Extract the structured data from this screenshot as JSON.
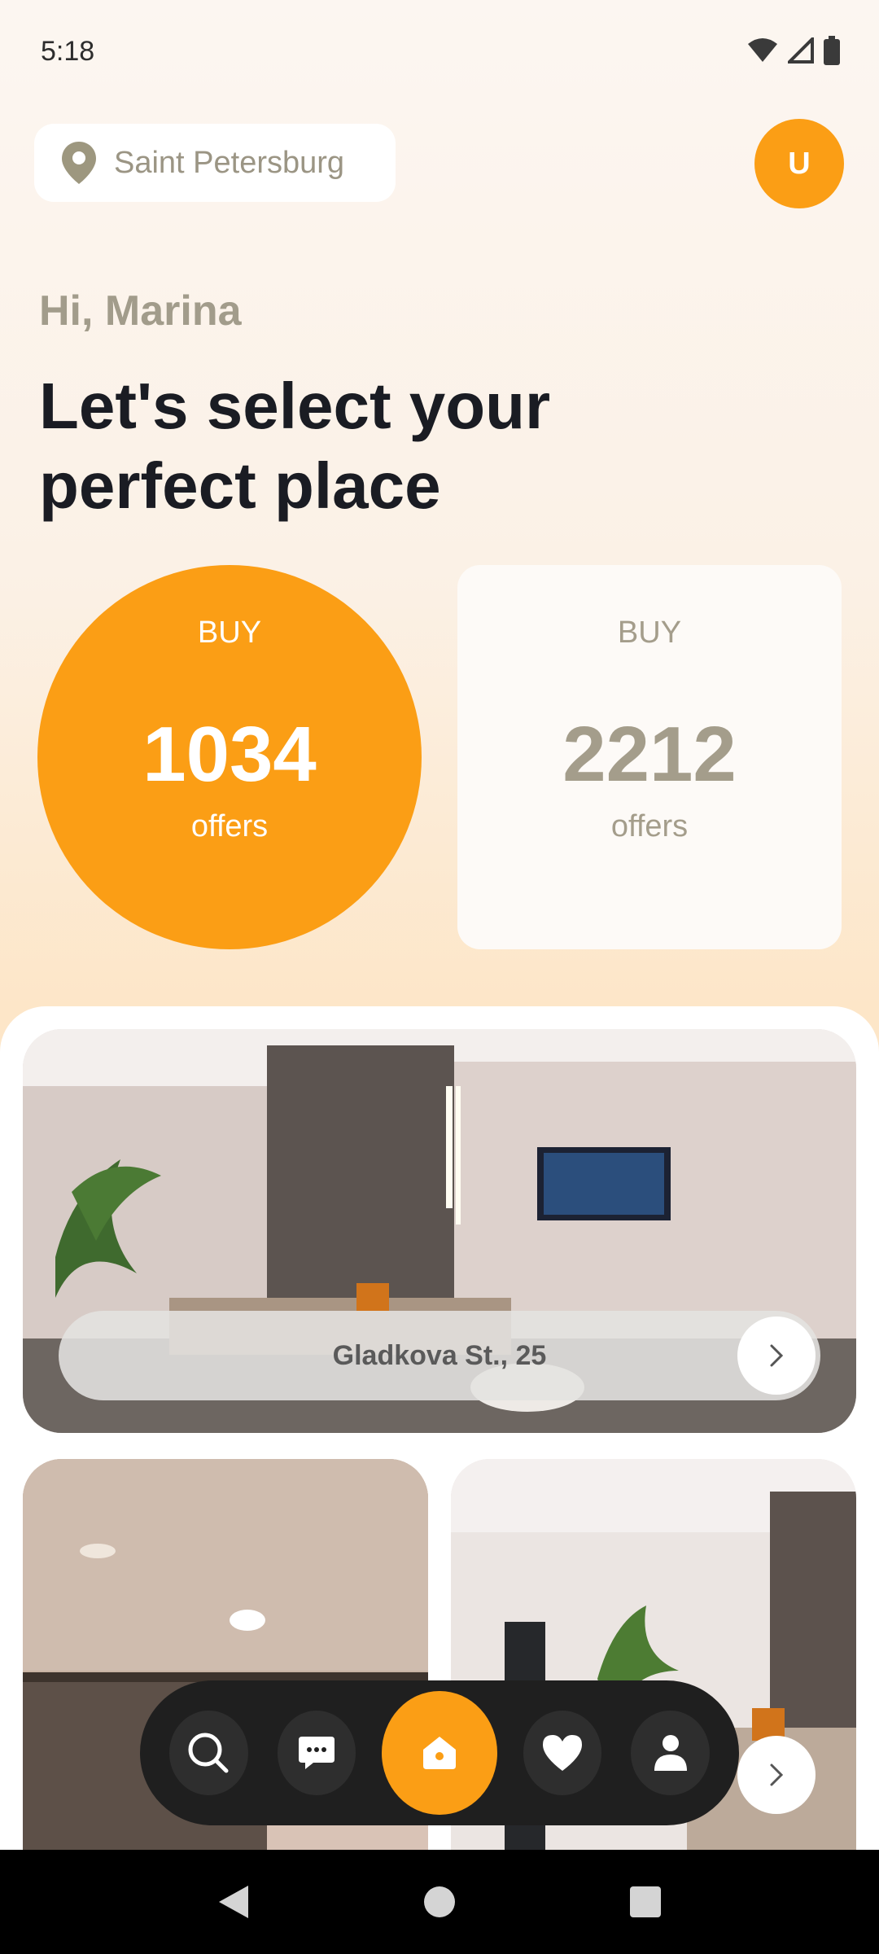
{
  "status_bar": {
    "time": "5:18"
  },
  "location": {
    "city": "Saint Petersburg"
  },
  "user": {
    "avatar_initial": "U"
  },
  "greeting": "Hi, Marina",
  "headline": "Let's select your perfect place",
  "stats": [
    {
      "type": "BUY",
      "count": "1034",
      "unit": "offers"
    },
    {
      "type": "BUY",
      "count": "2212",
      "unit": "offers"
    }
  ],
  "listings": [
    {
      "address": "Gladkova St., 25"
    }
  ],
  "bottom_nav": [
    "search",
    "chat",
    "home",
    "favorites",
    "profile"
  ],
  "colors": {
    "accent": "#fb9e15",
    "nav_bg": "#1f1f1f",
    "muted_text": "#a49d8b"
  }
}
